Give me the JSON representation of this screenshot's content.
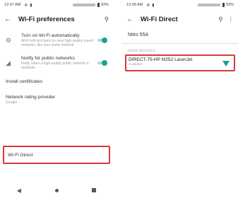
{
  "left": {
    "status": {
      "time": "12:07 AM",
      "battery": "93%"
    },
    "toolbar": {
      "title": "Wi-Fi preferences"
    },
    "prefs": [
      {
        "title": "Turn on Wi-Fi automatically",
        "summary": "Wi-Fi will turn back on near high-quality saved networks, like your home network",
        "toggle_on": true
      },
      {
        "title": "Notify for public networks",
        "summary": "Notify when a high-quality public network is available",
        "toggle_on": true
      }
    ],
    "install_certificates": "Install certificates",
    "network_rating": {
      "title": "Network rating provider",
      "summary": "Google"
    },
    "wifi_direct": "Wi-Fi Direct"
  },
  "right": {
    "status": {
      "time": "12:08 AM",
      "battery": "93%"
    },
    "toolbar": {
      "title": "Wi-Fi Direct"
    },
    "device_name": "Nitro 55A",
    "peer_devices_header": "PEER DEVICES",
    "peer": {
      "name": "DIRECT-75-HP M252 LaserJet",
      "status": "Available"
    }
  },
  "colors": {
    "accent": "#1fa08e",
    "highlight": "#d9373c"
  }
}
